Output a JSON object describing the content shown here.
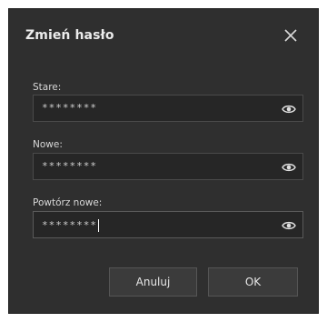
{
  "dialog": {
    "title": "Zmień hasło",
    "close_icon": "close-icon"
  },
  "fields": [
    {
      "label": "Stare:",
      "value": "********",
      "eye_icon": "eye-icon"
    },
    {
      "label": "Nowe:",
      "value": "********",
      "eye_icon": "eye-icon"
    },
    {
      "label": "Powtórz nowe:",
      "value": "********",
      "eye_icon": "eye-icon",
      "focused": true
    }
  ],
  "buttons": {
    "cancel_label": "Anuluj",
    "ok_label": "OK"
  },
  "colors": {
    "window_bg": "#2f2f2f",
    "field_bg": "#262626",
    "text": "#e6e6e6"
  }
}
